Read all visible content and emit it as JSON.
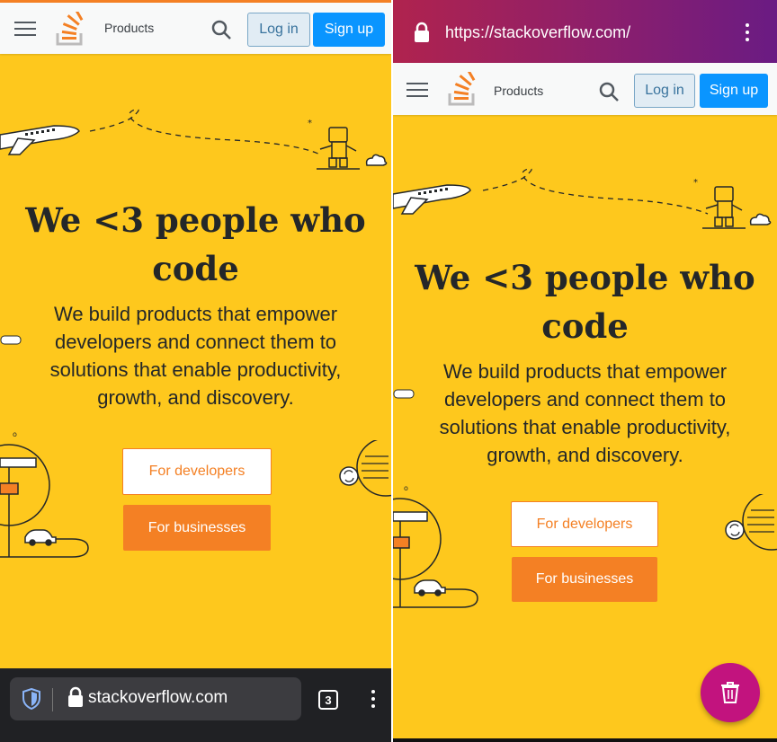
{
  "left": {
    "header": {
      "products_label": "Products",
      "login_label": "Log in",
      "signup_label": "Sign up"
    },
    "hero": {
      "title_line1": "We <3 people who",
      "title_line2": "code",
      "subtitle": "We build products that empower developers and connect them to solutions that enable productivity, growth, and discovery.",
      "btn_developers": "For developers",
      "btn_businesses": "For businesses"
    },
    "browser": {
      "url": "stackoverflow.com",
      "tab_count": "3"
    }
  },
  "right": {
    "browser": {
      "url": "https://stackoverflow.com/"
    },
    "header": {
      "products_label": "Products",
      "login_label": "Log in",
      "signup_label": "Sign up"
    },
    "hero": {
      "title_line1": "We <3 people who",
      "title_line2": "code",
      "subtitle": "We build products that empower developers and connect them to solutions that enable productivity, growth, and discovery.",
      "btn_developers": "For developers",
      "btn_businesses": "For businesses"
    }
  },
  "colors": {
    "hero_bg": "#fec81d",
    "accent_orange": "#f48024",
    "link_blue": "#0a95ff",
    "fab_pink": "#c2137e"
  },
  "icons": [
    "hamburger-icon",
    "stackoverflow-logo-icon",
    "search-icon",
    "shield-icon",
    "lock-icon",
    "tabs-icon",
    "more-vert-icon",
    "trash-icon"
  ]
}
